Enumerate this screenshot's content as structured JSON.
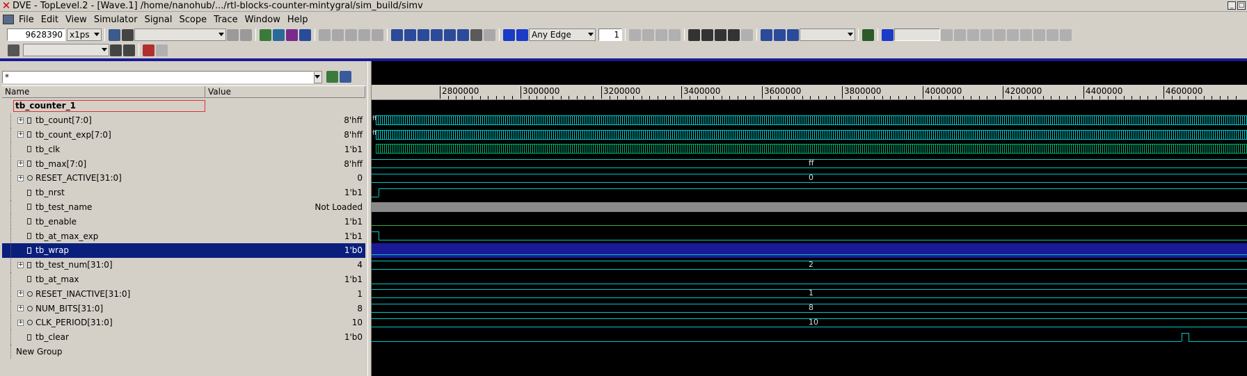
{
  "window": {
    "title": "DVE - TopLevel.2 - [Wave.1]  /home/nanohub/.../rtl-blocks-counter-mintygral/sim_build/simv",
    "controls": [
      "_",
      "□",
      "x"
    ]
  },
  "menu": [
    "File",
    "Edit",
    "View",
    "Simulator",
    "Signal",
    "Scope",
    "Trace",
    "Window",
    "Help"
  ],
  "toolbar": {
    "time_value": "9628390",
    "time_unit": "x1ps",
    "edge_select": "Any Edge",
    "edge_count": "1"
  },
  "signal_pane": {
    "filter": "*",
    "columns": {
      "name": "Name",
      "value": "Value"
    },
    "group": "tb_counter_1",
    "signals": [
      {
        "name": "tb_count[7:0]",
        "value": "8'hff",
        "bus": true,
        "kind": "signal"
      },
      {
        "name": "tb_count_exp[7:0]",
        "value": "8'hff",
        "bus": true,
        "kind": "signal"
      },
      {
        "name": "tb_clk",
        "value": "1'b1",
        "bus": false,
        "kind": "signal"
      },
      {
        "name": "tb_max[7:0]",
        "value": "8'hff",
        "bus": true,
        "kind": "signal"
      },
      {
        "name": "RESET_ACTIVE[31:0]",
        "value": "0",
        "bus": true,
        "kind": "param"
      },
      {
        "name": "tb_nrst",
        "value": "1'b1",
        "bus": false,
        "kind": "signal"
      },
      {
        "name": "tb_test_name",
        "value": "Not Loaded",
        "bus": false,
        "kind": "signal"
      },
      {
        "name": "tb_enable",
        "value": "1'b1",
        "bus": false,
        "kind": "signal"
      },
      {
        "name": "tb_at_max_exp",
        "value": "1'b1",
        "bus": false,
        "kind": "signal"
      },
      {
        "name": "tb_wrap",
        "value": "1'b0",
        "bus": false,
        "kind": "signal",
        "selected": true
      },
      {
        "name": "tb_test_num[31:0]",
        "value": "4",
        "bus": true,
        "kind": "signal"
      },
      {
        "name": "tb_at_max",
        "value": "1'b1",
        "bus": false,
        "kind": "signal"
      },
      {
        "name": "RESET_INACTIVE[31:0]",
        "value": "1",
        "bus": true,
        "kind": "param"
      },
      {
        "name": "NUM_BITS[31:0]",
        "value": "8",
        "bus": true,
        "kind": "param"
      },
      {
        "name": "CLK_PERIOD[31:0]",
        "value": "10",
        "bus": true,
        "kind": "param"
      },
      {
        "name": "tb_clear",
        "value": "1'b0",
        "bus": false,
        "kind": "signal"
      }
    ],
    "new_group": "New Group"
  },
  "wave_pane": {
    "ruler_ticks": [
      "2800000",
      "3000000",
      "3200000",
      "3400000",
      "3600000",
      "3800000",
      "4000000",
      "4200000",
      "4400000",
      "4600000"
    ],
    "bus_labels": {
      "tb_max": "ff",
      "reset_active": "0",
      "test_num": "2",
      "reset_inactive": "1",
      "num_bits": "8",
      "clk_period": "10",
      "count_start": "ff",
      "count_exp_start": "ff"
    },
    "colors": {
      "wave": "#00c8c8",
      "bus_clk": "#00b070",
      "selection": "#0a1e7c",
      "background": "#000000"
    }
  }
}
